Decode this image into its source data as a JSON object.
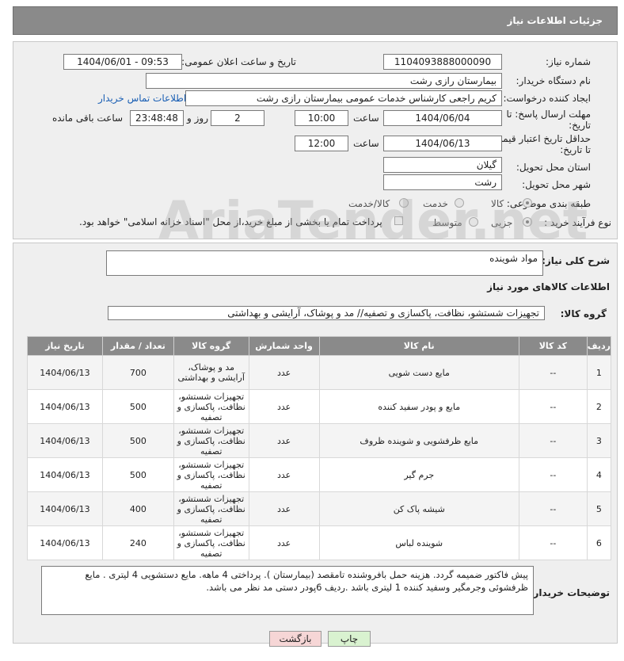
{
  "page": {
    "title": "جزئیات اطلاعات نیاز"
  },
  "form": {
    "need_number_label": "شماره نیاز:",
    "need_number": "1104093888000090",
    "announce_label": "تاریخ و ساعت اعلان عمومی:",
    "announce_value": "1404/06/01 - 09:53",
    "buyer_org_label": "نام دستگاه خریدار:",
    "buyer_org": "بیمارستان رازی رشت",
    "creator_label": "ایجاد کننده درخواست:",
    "creator": "کریم راجعی کارشناس خدمات عمومی بیمارستان رازی رشت",
    "contact_link": "اطلاعات تماس خریدار",
    "deadline_label_1": "مهلت ارسال پاسخ: تا",
    "deadline_label_2": "تاریخ:",
    "deadline_date": "1404/06/04",
    "time_label": "ساعت",
    "deadline_time": "10:00",
    "days_value": "2",
    "days_label": "روز و",
    "remaining_time": "23:48:48",
    "remaining_label": "ساعت باقی مانده",
    "validity_label_1": "حداقل تاریخ اعتبار قیمت:",
    "validity_label_2": "تا تاریخ:",
    "validity_date": "1404/06/13",
    "validity_time_label": "ساعت",
    "validity_time": "12:00",
    "province_label": "استان محل تحویل:",
    "province": "گیلان",
    "city_label": "شهر محل تحویل:",
    "city": "رشت",
    "category_label": "طبقه بندی موضوعی:",
    "category_options": [
      "کالا",
      "خدمت",
      "کالا/خدمت"
    ],
    "category_selected": "کالا",
    "process_label": "نوع فرآیند خرید :",
    "process_options": [
      "جزیی",
      "متوسط"
    ],
    "process_selected": "جزیی",
    "payment_note": "پرداخت تمام یا بخشی از مبلغ خرید،از محل \"اسناد خزانه اسلامی\" خواهد بود."
  },
  "details": {
    "description_label": "شرح کلی نیاز:",
    "description": "مواد شوینده",
    "goods_info_title": "اطلاعات کالاهای مورد نیاز",
    "goods_group_label": "گروه کالا:",
    "goods_group": "تجهیزات شستشو، نظافت، پاکسازی و تصفیه// مد و پوشاک، آرایشی و بهداشتی"
  },
  "table": {
    "headers": [
      "ردیف",
      "کد کالا",
      "نام کالا",
      "واحد شمارش",
      "گروه کالا",
      "تعداد / مقدار",
      "تاریخ نیاز"
    ],
    "rows": [
      {
        "row": "1",
        "code": "--",
        "name": "مایع دست شویی",
        "unit": "عدد",
        "group": "مد و پوشاک، آرایشی و بهداشتی",
        "qty": "700",
        "date": "1404/06/13"
      },
      {
        "row": "2",
        "code": "--",
        "name": "مایع و پودر سفید کننده",
        "unit": "عدد",
        "group": "تجهیزات شستشو، نظافت، پاکسازی و تصفیه",
        "qty": "500",
        "date": "1404/06/13"
      },
      {
        "row": "3",
        "code": "--",
        "name": "مایع ظرفشویی و شوینده ظروف",
        "unit": "عدد",
        "group": "تجهیزات شستشو، نظافت، پاکسازی و تصفیه",
        "qty": "500",
        "date": "1404/06/13"
      },
      {
        "row": "4",
        "code": "--",
        "name": "جرم گیر",
        "unit": "عدد",
        "group": "تجهیزات شستشو، نظافت، پاکسازی و تصفیه",
        "qty": "500",
        "date": "1404/06/13"
      },
      {
        "row": "5",
        "code": "--",
        "name": "شیشه پاک کن",
        "unit": "عدد",
        "group": "تجهیزات شستشو، نظافت، پاکسازی و تصفیه",
        "qty": "400",
        "date": "1404/06/13"
      },
      {
        "row": "6",
        "code": "--",
        "name": "شوینده لباس",
        "unit": "عدد",
        "group": "تجهیزات شستشو، نظافت، پاکسازی و تصفیه",
        "qty": "240",
        "date": "1404/06/13"
      }
    ]
  },
  "buyer_notes": {
    "label": "توضیحات خریدار:",
    "text": "پیش فاکتور ضمیمه گردد. هزینه حمل بافروشنده تامقصد (بیمارستان ). پرداختی 4 ماهه. مایع دستشویی 4 لیتری . مایع ظرفشوئی وجرمگیر وسفید کننده 1 لیتری باشد .ردیف 6پودر دستی مد نظر می باشد."
  },
  "buttons": {
    "print": "چاپ",
    "back": "بازگشت"
  },
  "watermark": "AriaTender.net",
  "colors": {
    "header_bg": "#8a8a8a",
    "panel_bg": "#efefef",
    "link": "#1a5fb4",
    "back_btn": "#f6d6d6",
    "print_btn": "#d9f2d0"
  }
}
